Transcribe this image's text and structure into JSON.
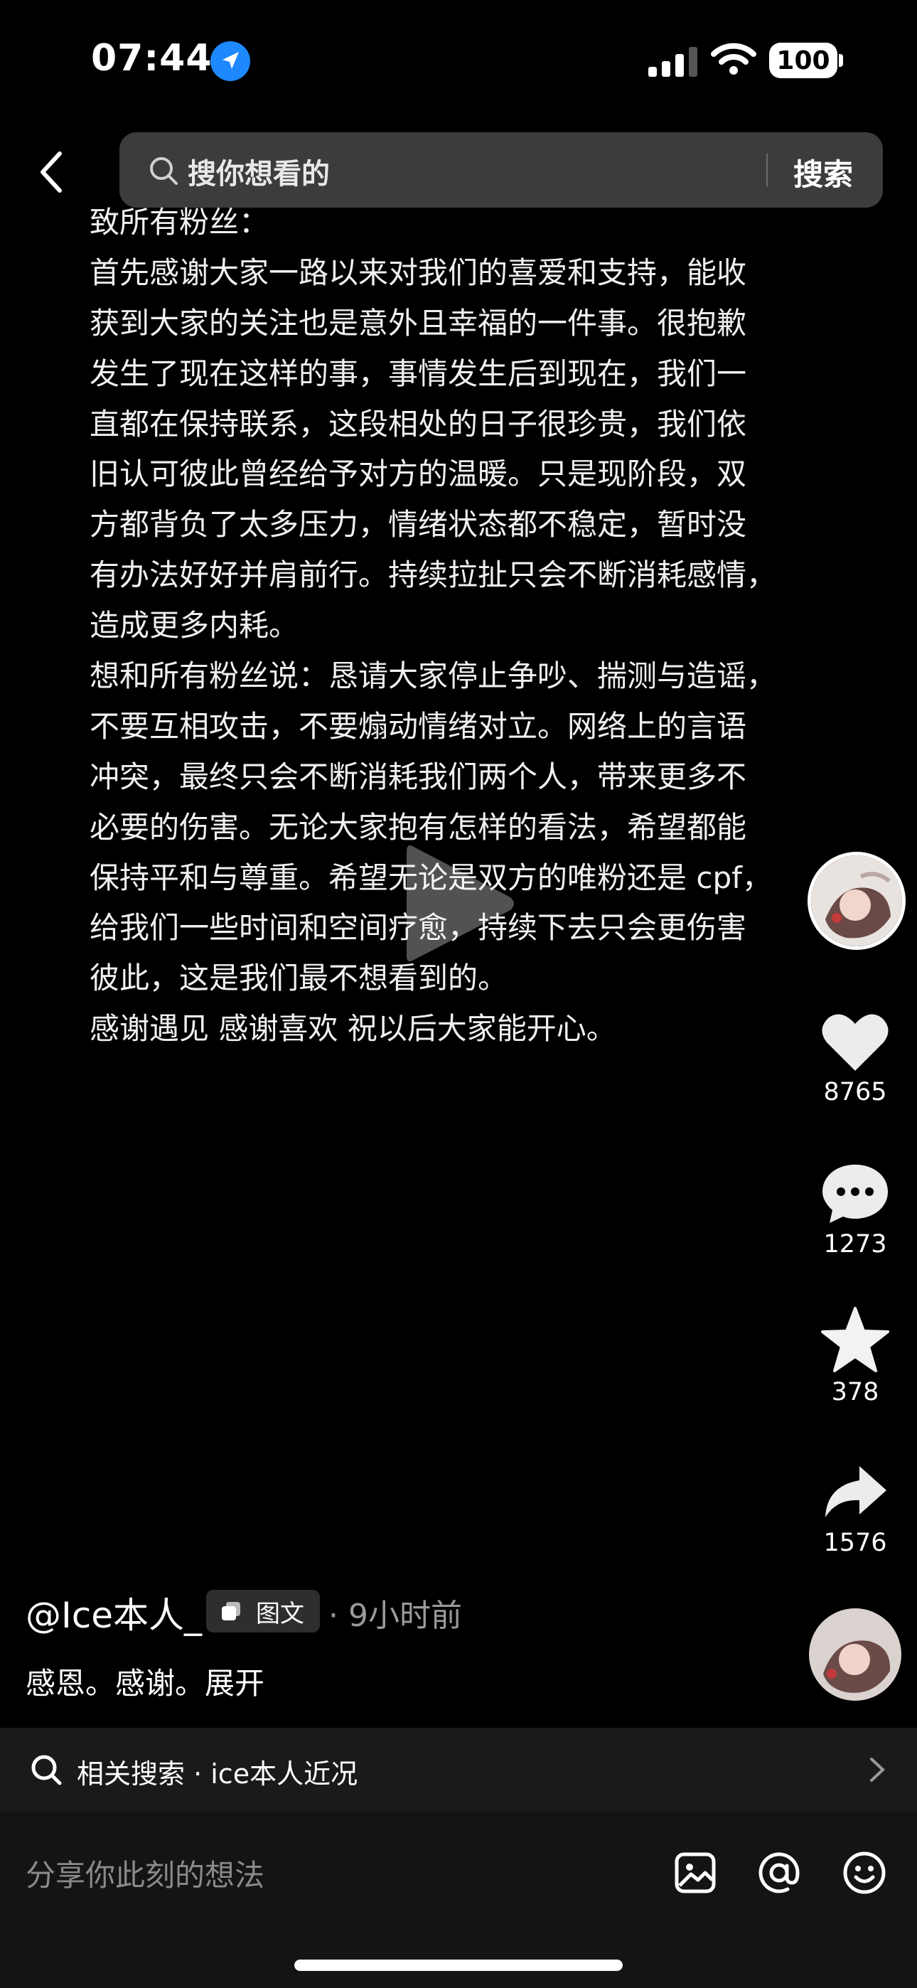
{
  "status_bar": {
    "time": "07:44",
    "battery": "100"
  },
  "search": {
    "placeholder": "搜你想看的",
    "button": "搜索"
  },
  "post": {
    "lines": [
      "致所有粉丝：",
      "首先感谢大家一路以来对我们的喜爱和支持，能收",
      "获到大家的关注也是意外且幸福的一件事。很抱歉",
      "发生了现在这样的事，事情发生后到现在，我们一",
      "直都在保持联系，这段相处的日子很珍贵，我们依",
      "旧认可彼此曾经给予对方的温暖。只是现阶段，双",
      "方都背负了太多压力，情绪状态都不稳定，暂时没",
      "有办法好好并肩前行。持续拉扯只会不断消耗感情，",
      "造成更多内耗。",
      "想和所有粉丝说：恳请大家停止争吵、揣测与造谣，",
      "不要互相攻击，不要煽动情绪对立。网络上的言语",
      "冲突，最终只会不断消耗我们两个人，带来更多不",
      "必要的伤害。无论大家抱有怎样的看法，希望都能",
      "保持平和与尊重。希望无论是双方的唯粉还是 cpf，",
      "给我们一些时间和空间疗愈，持续下去只会更伤害",
      "彼此，这是我们最不想看到的。",
      "感谢遇见 感谢喜欢 祝以后大家能开心。"
    ]
  },
  "actions": {
    "likes": "8765",
    "comments": "1273",
    "favorites": "378",
    "shares": "1576"
  },
  "author": {
    "handle": "@Ice本人_",
    "tag": "图文",
    "time": "· 9小时前",
    "caption": "感恩。感谢。展开"
  },
  "related": {
    "text": "相关搜索 · ice本人近况"
  },
  "comment_input": {
    "placeholder": "分享你此刻的想法"
  },
  "icons": [
    "location-arrow-icon",
    "signal-icon",
    "wifi-icon",
    "back-icon",
    "search-icon",
    "play-icon",
    "heart-icon",
    "comment-icon",
    "star-icon",
    "share-icon",
    "image-icon",
    "at-icon",
    "emoji-icon",
    "chevron-right-icon"
  ]
}
